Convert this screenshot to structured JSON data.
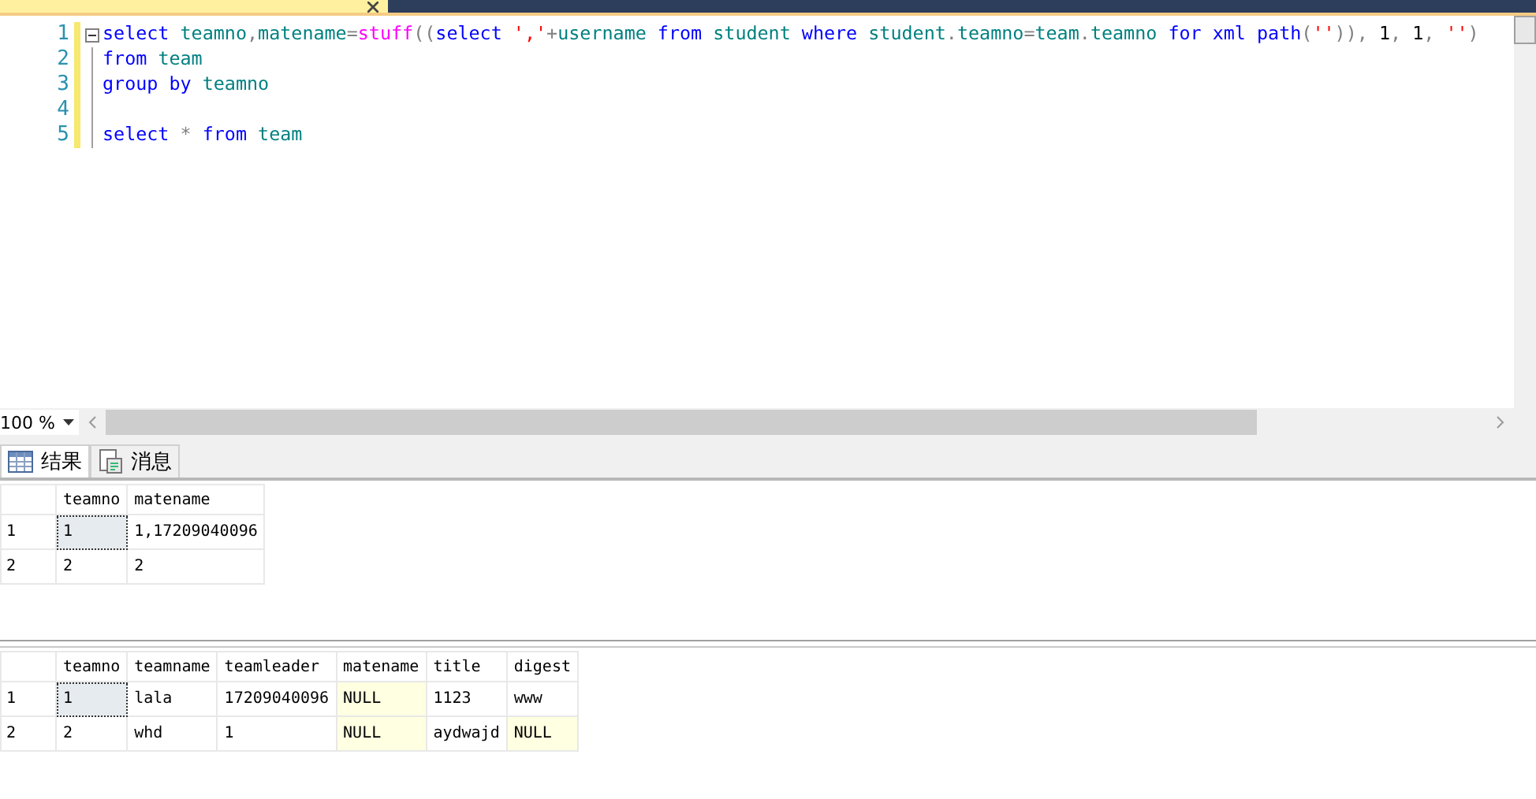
{
  "editor": {
    "lines": [
      {
        "number": "1",
        "foldable": true,
        "tokens": [
          {
            "kind": "kw",
            "text": "select"
          },
          {
            "kind": "id",
            "text": " teamno"
          },
          {
            "kind": "op",
            "text": ","
          },
          {
            "kind": "id",
            "text": "matename"
          },
          {
            "kind": "op",
            "text": "="
          },
          {
            "kind": "fn",
            "text": "stuff"
          },
          {
            "kind": "op",
            "text": "(("
          },
          {
            "kind": "kw",
            "text": "select"
          },
          {
            "kind": "str",
            "text": " ','"
          },
          {
            "kind": "op",
            "text": "+"
          },
          {
            "kind": "id",
            "text": "username"
          },
          {
            "kind": "kw",
            "text": " from"
          },
          {
            "kind": "id",
            "text": " student"
          },
          {
            "kind": "kw",
            "text": " where"
          },
          {
            "kind": "id",
            "text": " student"
          },
          {
            "kind": "op",
            "text": "."
          },
          {
            "kind": "id",
            "text": "teamno"
          },
          {
            "kind": "op",
            "text": "="
          },
          {
            "kind": "id",
            "text": "team"
          },
          {
            "kind": "op",
            "text": "."
          },
          {
            "kind": "id",
            "text": "teamno"
          },
          {
            "kind": "kw",
            "text": " for xml path"
          },
          {
            "kind": "op",
            "text": "("
          },
          {
            "kind": "str",
            "text": "''"
          },
          {
            "kind": "op",
            "text": ")),"
          },
          {
            "kind": "num",
            "text": " 1"
          },
          {
            "kind": "op",
            "text": ","
          },
          {
            "kind": "num",
            "text": " 1"
          },
          {
            "kind": "op",
            "text": ","
          },
          {
            "kind": "str",
            "text": " ''"
          },
          {
            "kind": "op",
            "text": ")"
          }
        ]
      },
      {
        "number": "2",
        "foldable": false,
        "tokens": [
          {
            "kind": "kw",
            "text": "from"
          },
          {
            "kind": "id",
            "text": " team"
          }
        ]
      },
      {
        "number": "3",
        "foldable": false,
        "tokens": [
          {
            "kind": "kw",
            "text": "group by"
          },
          {
            "kind": "id",
            "text": " teamno"
          }
        ]
      },
      {
        "number": "4",
        "foldable": false
      },
      {
        "number": "5",
        "foldable": false,
        "tokens": [
          {
            "kind": "kw",
            "text": "select"
          },
          {
            "kind": "op",
            "text": " *"
          },
          {
            "kind": "kw",
            "text": " from"
          },
          {
            "kind": "id",
            "text": " team"
          }
        ]
      }
    ]
  },
  "zoom": "100 %",
  "result_tabs": [
    {
      "label": "结果",
      "selected": true,
      "kind": "grid"
    },
    {
      "label": "消息",
      "selected": false,
      "kind": "messages"
    }
  ],
  "grids": [
    {
      "columns": [
        "teamno",
        "matename"
      ],
      "rows": [
        {
          "header": "1",
          "cells": [
            {
              "text": "1",
              "selected": true,
              "null": false
            },
            {
              "text": "1,17209040096",
              "selected": false,
              "null": false
            }
          ]
        },
        {
          "header": "2",
          "cells": [
            {
              "text": "2",
              "selected": false,
              "null": false
            },
            {
              "text": "2",
              "selected": false,
              "null": false
            }
          ]
        }
      ]
    },
    {
      "columns": [
        "teamno",
        "teamname",
        "teamleader",
        "matename",
        "title",
        "digest"
      ],
      "rows": [
        {
          "header": "1",
          "cells": [
            {
              "text": "1",
              "selected": true,
              "null": false
            },
            {
              "text": "lala",
              "selected": false,
              "null": false
            },
            {
              "text": "17209040096",
              "selected": false,
              "null": false
            },
            {
              "text": "NULL",
              "selected": false,
              "null": true
            },
            {
              "text": "1123",
              "selected": false,
              "null": false
            },
            {
              "text": "www",
              "selected": false,
              "null": false
            }
          ]
        },
        {
          "header": "2",
          "cells": [
            {
              "text": "2",
              "selected": false,
              "null": false
            },
            {
              "text": "whd",
              "selected": false,
              "null": false
            },
            {
              "text": "1",
              "selected": false,
              "null": false
            },
            {
              "text": "NULL",
              "selected": false,
              "null": true
            },
            {
              "text": "aydwajd",
              "selected": false,
              "null": false
            },
            {
              "text": "NULL",
              "selected": false,
              "null": true
            }
          ]
        }
      ]
    }
  ]
}
